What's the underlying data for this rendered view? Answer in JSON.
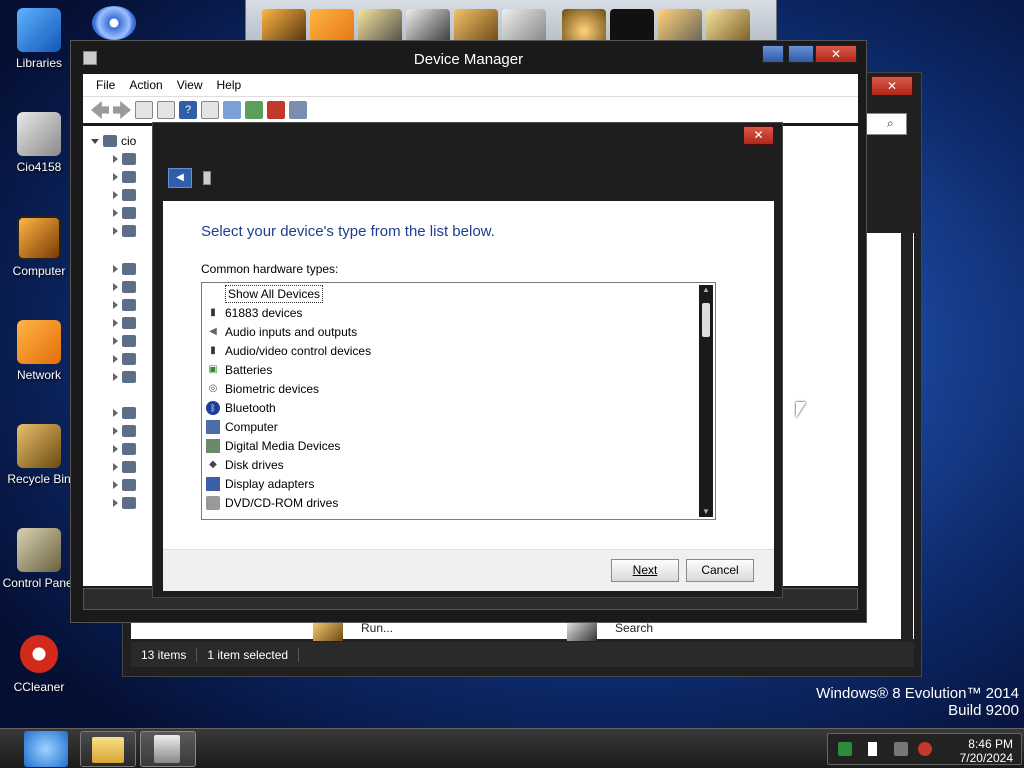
{
  "desktop": {
    "icons": [
      {
        "label": "Libraries"
      },
      {
        "label": "Cio4158"
      },
      {
        "label": "Computer"
      },
      {
        "label": "Network"
      },
      {
        "label": "Recycle Bin"
      },
      {
        "label": "Control Panel"
      },
      {
        "label": "CCleaner"
      }
    ],
    "watermark_line1": "Windows® 8 Evolution™ 2014",
    "watermark_line2": "Build 9200"
  },
  "device_manager": {
    "title": "Device Manager",
    "menu": [
      "File",
      "Action",
      "View",
      "Help"
    ],
    "tree_root": "cio"
  },
  "background_window": {
    "status_items": "13 items",
    "status_selected": "1 item selected",
    "run_label": "Run...",
    "search_label": "Search"
  },
  "dialog": {
    "heading": "Select your device's type from the list below.",
    "list_label": "Common hardware types:",
    "items": [
      {
        "label": "Show All Devices",
        "icon": "none",
        "selected": true
      },
      {
        "label": "61883 devices",
        "icon": "usb-plug-icon"
      },
      {
        "label": "Audio inputs and outputs",
        "icon": "speaker-icon"
      },
      {
        "label": "Audio/video control devices",
        "icon": "usb-plug-icon"
      },
      {
        "label": "Batteries",
        "icon": "battery-icon"
      },
      {
        "label": "Biometric devices",
        "icon": "fingerprint-icon"
      },
      {
        "label": "Bluetooth",
        "icon": "bluetooth-icon"
      },
      {
        "label": "Computer",
        "icon": "computer-icon"
      },
      {
        "label": "Digital Media Devices",
        "icon": "media-device-icon"
      },
      {
        "label": "Disk drives",
        "icon": "disk-drive-icon"
      },
      {
        "label": "Display adapters",
        "icon": "display-adapter-icon"
      },
      {
        "label": "DVD/CD-ROM drives",
        "icon": "dvd-drive-icon"
      }
    ],
    "next_label": "Next",
    "cancel_label": "Cancel",
    "close_label": "✕"
  },
  "taskbar": {
    "time": "8:46 PM",
    "date": "7/20/2024"
  },
  "colors": {
    "heading_blue": "#1c3f8f",
    "close_red": "#c0392b"
  }
}
